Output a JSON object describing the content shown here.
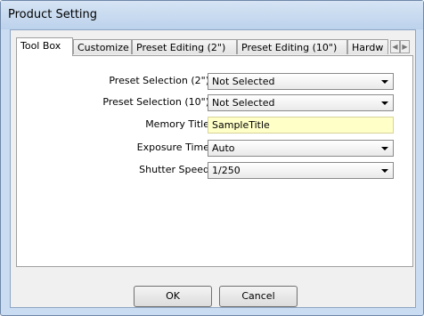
{
  "window": {
    "title": "Product Setting"
  },
  "tabs": [
    {
      "label": "Tool Box"
    },
    {
      "label": "Customize"
    },
    {
      "label": "Preset Editing (2\")"
    },
    {
      "label": "Preset Editing (10\")"
    },
    {
      "label": "Hardw"
    }
  ],
  "form": {
    "preset2": {
      "label": "Preset Selection (2\")",
      "value": "Not Selected"
    },
    "preset10": {
      "label": "Preset Selection (10\")",
      "value": "Not Selected"
    },
    "memory_title": {
      "label": "Memory Title",
      "value": "SampleTitle"
    },
    "exposure": {
      "label": "Exposure Time",
      "value": "Auto"
    },
    "shutter": {
      "label": "Shutter Speed",
      "value": "1/250"
    }
  },
  "buttons": {
    "ok": "OK",
    "cancel": "Cancel"
  },
  "icons": {
    "tab_scroll_left": "chevron-left-icon",
    "tab_scroll_right": "chevron-right-icon",
    "dropdown": "chevron-down-icon"
  }
}
